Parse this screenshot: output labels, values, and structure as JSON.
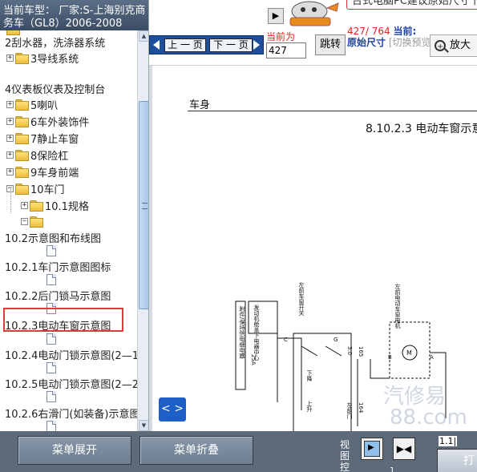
{
  "vehicle_header": {
    "text": "当前车型： 厂家:S-上海别克商务车（GL8）2006-2008"
  },
  "toolbar": {
    "prev_page": "上 一 页",
    "next_page": "下 一 页",
    "current_label": "当前为",
    "page_value": "427",
    "jump": "跳转",
    "page_count": "427/ 764",
    "current_prefix": "当前:",
    "current_mode": "原始尺寸",
    "switch_hint": "[切换预览尺寸]",
    "zoom": "放大",
    "notice": "台式电脑PC建议原始尺寸下"
  },
  "tree": {
    "items": [
      {
        "label": "2刮水器，洗涤器系统"
      },
      {
        "label": "3导线系统"
      },
      {
        "label": "4仪表板仪表及控制台"
      },
      {
        "label": "5喇叭"
      },
      {
        "label": "6车外装饰件"
      },
      {
        "label": "7静止车窗"
      },
      {
        "label": "8保险杠"
      },
      {
        "label": "9车身前端"
      },
      {
        "label": "10车门"
      },
      {
        "label": "10.1规格"
      },
      {
        "label": "10.2示意图和布线图"
      },
      {
        "label": "10.2.1车门示意图图标"
      },
      {
        "label": "10.2.2后门锁马示意图"
      },
      {
        "label": "10.2.3电动车窗示意图"
      },
      {
        "label": "10.2.4电动门锁示意图(2—1"
      },
      {
        "label": "10.2.5电动门锁示意图(2—2"
      },
      {
        "label": "10.2.6右滑门(如装备)示意图"
      }
    ]
  },
  "document": {
    "section": "车身",
    "title": "8.10.2.3 电动车窗示意",
    "diagram_labels": {
      "a": "附件/保持供电继电器",
      "b": "发动机舱盖下电器中心",
      "c": "左前车窗开关",
      "d": "左前电动车窗电机",
      "fuse": "25A",
      "down": "下降",
      "up": "上升",
      "left_door": "左前门",
      "wire1": "3.0",
      "wire2": "164",
      "wire3": "165",
      "pin_b": "B",
      "pin_a": "A",
      "pin_c": "C",
      "pin_g": "G"
    },
    "page_nav": "< >",
    "watermark1": "汽修易",
    "watermark2": "88.com"
  },
  "bottom": {
    "expand": "菜单展开",
    "collapse": "菜单折叠",
    "view_label": "视图控",
    "page_ratio": "1.1|",
    "small": "1",
    "print": "打"
  }
}
